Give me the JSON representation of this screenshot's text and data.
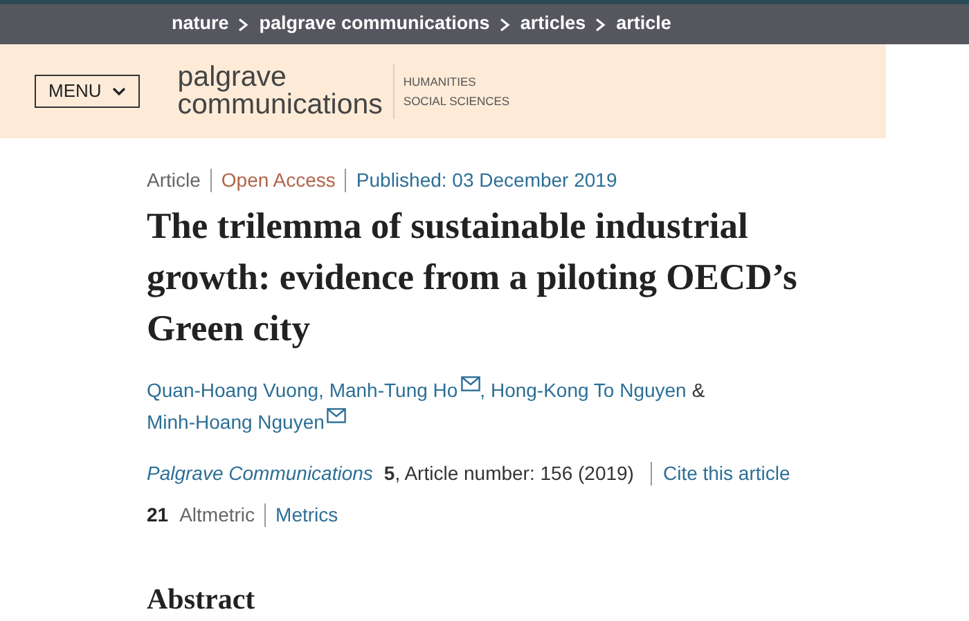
{
  "breadcrumbs": [
    "nature",
    "palgrave communications",
    "articles",
    "article"
  ],
  "header": {
    "menu_button": "MENU",
    "logo_line_1": "palgrave",
    "logo_line_2": "communications",
    "subjects": [
      "HUMANITIES",
      "SOCIAL SCIENCES"
    ]
  },
  "article_info": [
    {
      "kind": "type",
      "text": "Article"
    },
    {
      "kind": "access",
      "text": "Open Access"
    },
    {
      "kind": "date",
      "text": "Published: 03 December 2019"
    }
  ],
  "title": "The trilemma of sustainable industrial growth: evidence from a piloting OECD’s Green city",
  "authors": [
    {
      "name": "Quan-Hoang Vuong",
      "email": false,
      "separator": ","
    },
    {
      "name": "Manh-Tung Ho",
      "email": true,
      "separator": ","
    },
    {
      "name": "Hong-Kong To Nguyen",
      "email": false,
      "separator": "&"
    },
    {
      "name": "Minh-Hoang Nguyen",
      "email": true
    }
  ],
  "citation": {
    "journal": "Palgrave Communications",
    "volume": "5",
    "details": ", Article number: 156 (2019)",
    "cite_link": "Cite this article"
  },
  "metrics": {
    "count": "21",
    "label": "Altmetric",
    "link": "Metrics"
  },
  "section_heading": "Abstract"
}
